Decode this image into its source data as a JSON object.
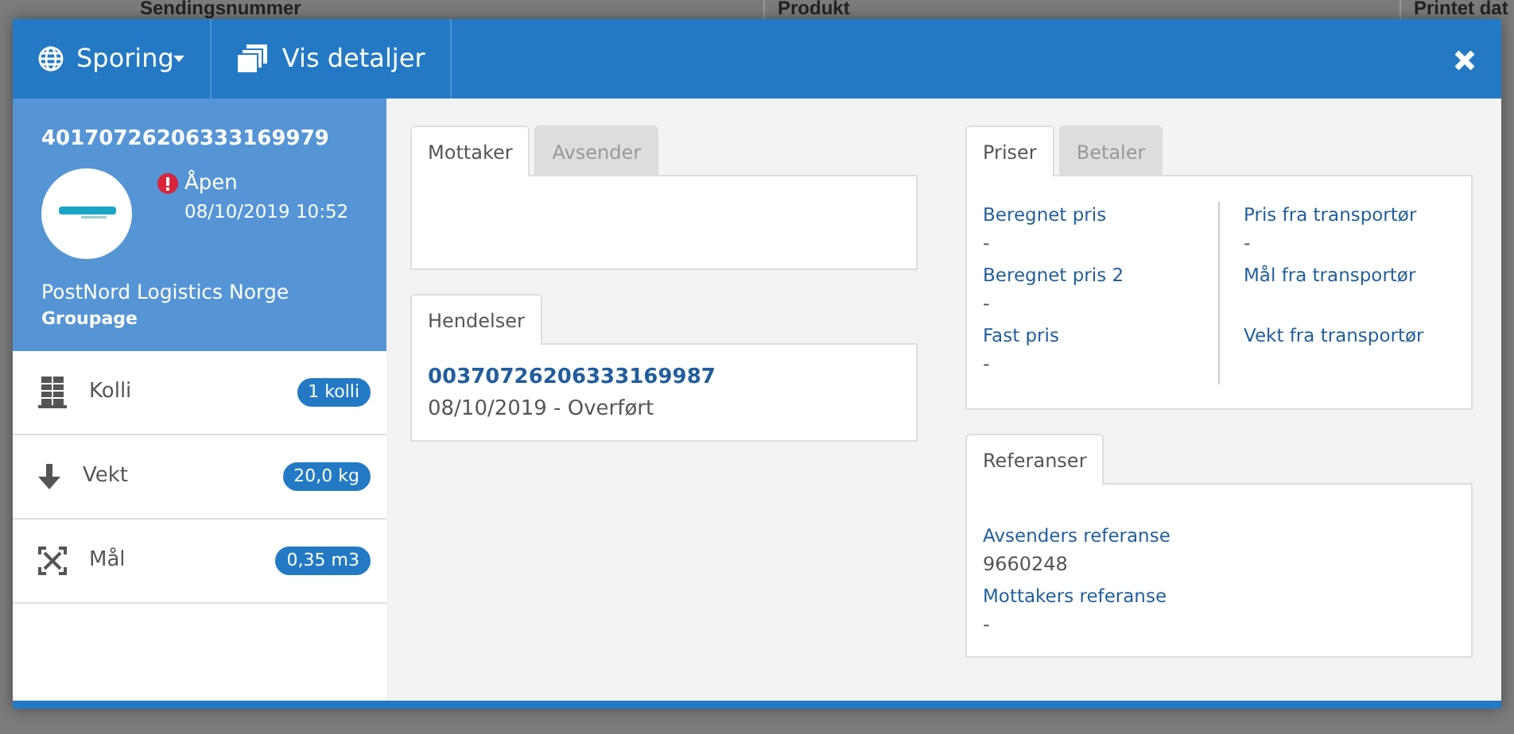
{
  "backdrop": {
    "columns": [
      "Sendingsnummer",
      "Produkt",
      "Printet dat"
    ]
  },
  "toolbar": [
    {
      "kind": "dropdown",
      "label": "Sporing"
    },
    {
      "kind": "button",
      "label": "Vis detaljer"
    }
  ],
  "shipment": {
    "number": "40170726206333169979",
    "status": {
      "label": "Åpen",
      "alert": true
    },
    "timestamp": "08/10/2019 10:52",
    "carrier": "PostNord Logistics Norge",
    "product": "Groupage"
  },
  "metrics": [
    {
      "kind": "packages",
      "label": "Kolli",
      "value": "1 kolli"
    },
    {
      "kind": "weight",
      "label": "Vekt",
      "value": "20,0 kg"
    },
    {
      "kind": "dimensions",
      "label": "Mål",
      "value": "0,35 m3"
    }
  ],
  "parties": {
    "tabs": [
      {
        "label": "Mottaker",
        "selected": true
      },
      {
        "label": "Avsender",
        "selected": false
      }
    ]
  },
  "events": {
    "tabs": [
      {
        "label": "Hendelser",
        "selected": true
      }
    ],
    "items": [
      {
        "number": "00370726206333169987",
        "description": "08/10/2019 - Overført"
      }
    ]
  },
  "prices": {
    "tabs": [
      {
        "label": "Priser",
        "selected": true
      },
      {
        "label": "Betaler",
        "selected": false
      }
    ],
    "left": [
      {
        "label": "Beregnet pris",
        "value": "-"
      },
      {
        "label": "Beregnet pris 2",
        "value": "-"
      },
      {
        "label": "Fast pris",
        "value": "-"
      }
    ],
    "right": [
      {
        "label": "Pris fra transportør",
        "value": "-"
      },
      {
        "label": "Mål fra transportør"
      },
      {
        "label": "Vekt fra transportør"
      }
    ]
  },
  "references": {
    "tabs": [
      {
        "label": "Referanser",
        "selected": true
      }
    ],
    "fields": [
      {
        "label": "Avsenders referanse",
        "value": "9660248"
      },
      {
        "label": "Mottakers referanse",
        "value": "-"
      }
    ]
  }
}
